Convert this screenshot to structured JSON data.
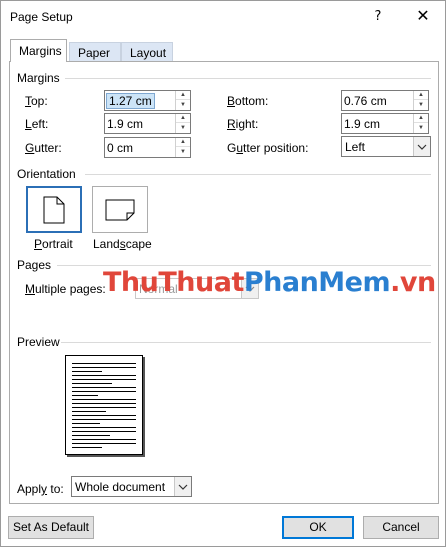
{
  "window": {
    "title": "Page Setup",
    "help_glyph": "?",
    "close_glyph": "✕"
  },
  "tabs": [
    {
      "label": "Margins",
      "active": true
    },
    {
      "label": "Paper",
      "active": false
    },
    {
      "label": "Layout",
      "active": false
    }
  ],
  "margins": {
    "section_title": "Margins",
    "top": {
      "label_u": "T",
      "label_rest": "op:",
      "value": "1.27 cm"
    },
    "bottom": {
      "label_u": "B",
      "label_rest": "ottom:",
      "value": "0.76 cm"
    },
    "left": {
      "label_u": "L",
      "label_rest": "eft:",
      "value": "1.9 cm"
    },
    "right": {
      "label_u": "R",
      "label_rest": "ight:",
      "value": "1.9 cm"
    },
    "gutter": {
      "label_u": "G",
      "label_rest": "utter:",
      "value": "0 cm"
    },
    "gutter_position": {
      "label_pre": "G",
      "label_u": "u",
      "label_rest": "tter position:",
      "value": "Left"
    }
  },
  "orientation": {
    "section_title": "Orientation",
    "portrait": {
      "label_u": "P",
      "label_rest": "ortrait"
    },
    "landscape": {
      "label_pre": "Land",
      "label_u": "s",
      "label_rest": "cape"
    }
  },
  "pages": {
    "section_title": "Pages",
    "multiple_pages": {
      "label_u": "M",
      "label_rest": "ultiple pages:",
      "value": "Normal"
    }
  },
  "preview": {
    "section_title": "Preview"
  },
  "apply_to": {
    "label_pre": "Appl",
    "label_u": "y",
    "label_rest": " to:",
    "value": "Whole document"
  },
  "buttons": {
    "set_default": "Set As Default",
    "ok": "OK",
    "cancel": "Cancel"
  },
  "watermark": {
    "part1": "ThuThuat",
    "part2": "PhanMem",
    "part3": ".vn"
  },
  "colors": {
    "accent": "#0078d7",
    "selection": "#cce4f7",
    "tab_inactive": "#dce6f4",
    "watermark_red": "#e0463a",
    "watermark_blue": "#2a7fd0"
  }
}
